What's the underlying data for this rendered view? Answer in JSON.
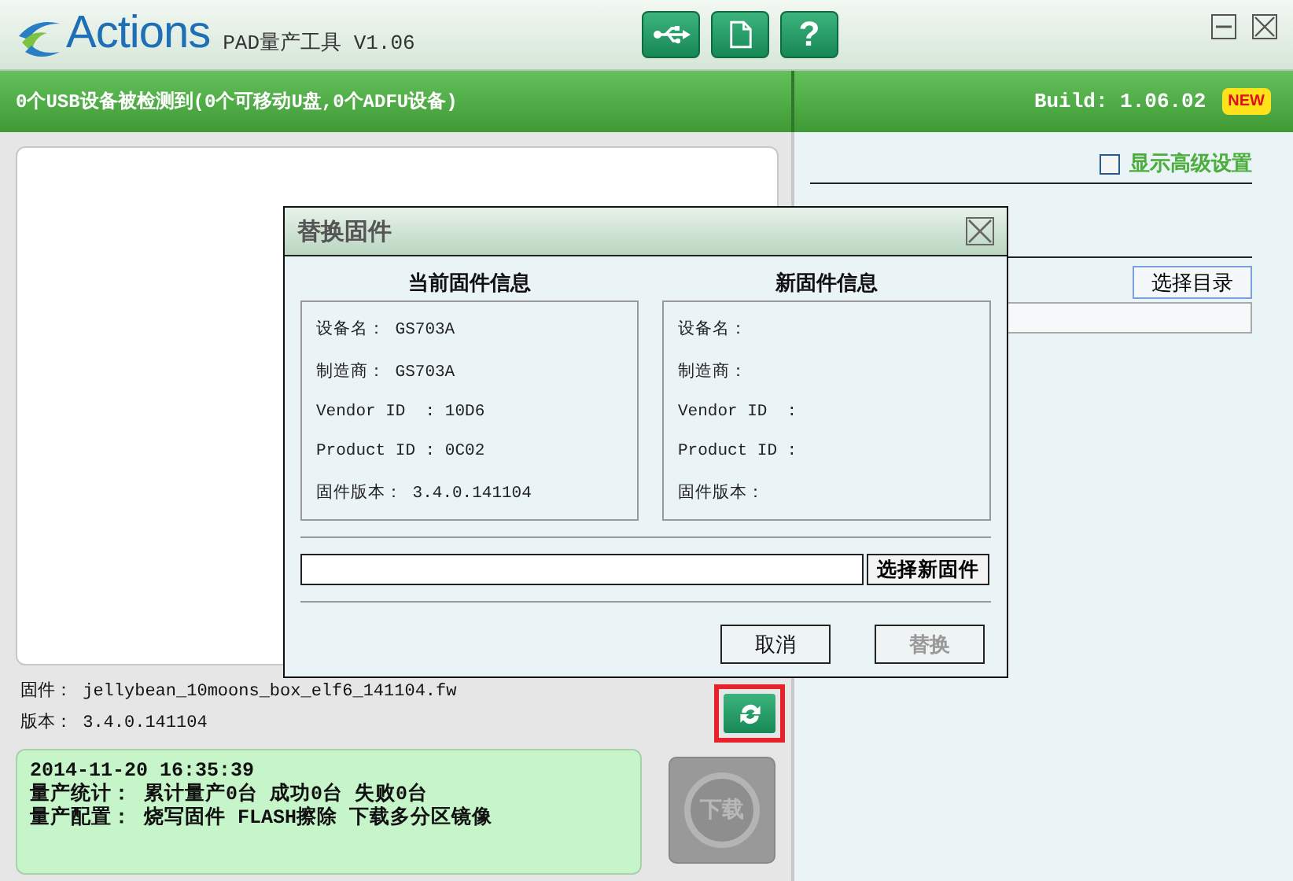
{
  "window": {
    "logo": "Actions",
    "title": "PAD量产工具 V1.06"
  },
  "toolbar": [
    {
      "kind": "usb"
    },
    {
      "kind": "document"
    },
    {
      "kind": "help",
      "label": "?"
    }
  ],
  "window_controls": [
    {
      "kind": "minimize"
    },
    {
      "kind": "close"
    }
  ],
  "status_bar": {
    "message": "0个USB设备被检测到(0个可移动U盘,0个ADFU设备)",
    "build": "Build: 1.06.02",
    "badge": "NEW"
  },
  "firmware": [
    "固件： jellybean_10moons_box_elf6_141104.fw",
    "版本： 3.4.0.141104"
  ],
  "log": [
    "2014-11-20 16:35:39",
    "量产统计： 累计量产0台 成功0台 失败0台",
    "量产配置： 烧写固件 FLASH擦除 下载多分区镜像"
  ],
  "download_button": {
    "label": "下载",
    "disabled": true
  },
  "settings": {
    "advanced": {
      "label": "显示高级设置",
      "checked": false
    },
    "select_dir_button": "选择目录"
  },
  "dialog": {
    "title": "替换固件",
    "panels": [
      {
        "heading": "当前固件信息",
        "rows": [
          "设备名： GS703A",
          "制造商： GS703A",
          "Vendor ID  : 10D6",
          "Product ID : 0C02",
          "固件版本： 3.4.0.141104"
        ]
      },
      {
        "heading": "新固件信息",
        "rows": [
          "设备名：",
          "制造商：",
          "Vendor ID  :",
          "Product ID :",
          "固件版本："
        ]
      }
    ],
    "choose_button": "选择新固件",
    "buttons": [
      {
        "label": "取消",
        "disabled": false
      },
      {
        "label": "替换",
        "disabled": true
      }
    ]
  }
}
